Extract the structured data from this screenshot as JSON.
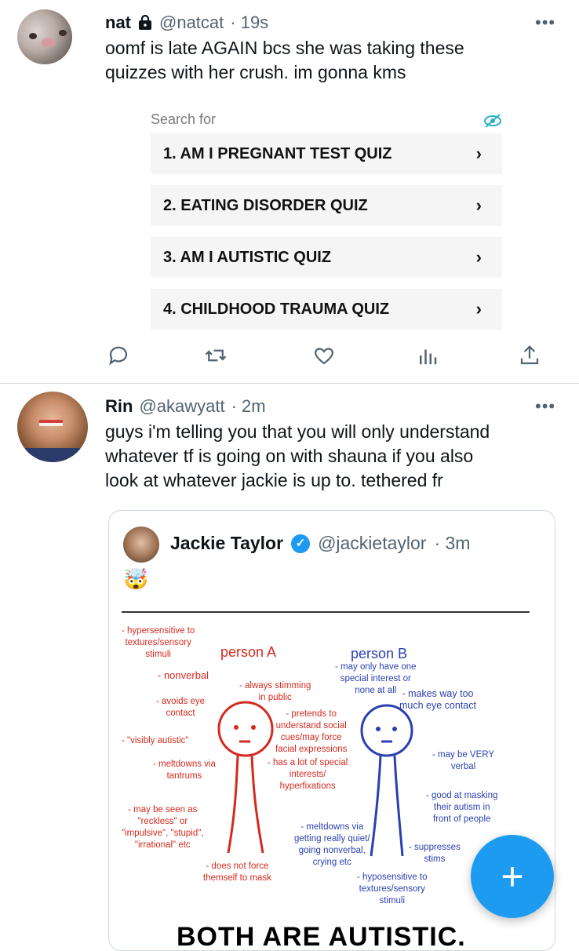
{
  "tweet1": {
    "name": "nat",
    "handle": "@natcat",
    "time": "· 19s",
    "more": "•••",
    "text_lines": [
      "oomf is late AGAIN bcs she was taking these",
      "quizzes with her crush. im gonna kms"
    ],
    "image": {
      "search_label": "Search for",
      "items": [
        "1.  AM I PREGNANT TEST QUIZ",
        "2.  EATING DISORDER QUIZ",
        "3.  AM I AUTISTIC QUIZ",
        "4.  CHILDHOOD TRAUMA QUIZ"
      ],
      "chevron": "›"
    }
  },
  "tweet2": {
    "name": "Rin",
    "handle": "@akawyatt",
    "time": "· 2m",
    "more": "•••",
    "text_lines": [
      "guys i'm telling you that you will only understand",
      "whatever tf is going on with shauna if you also",
      "look at whatever jackie is up to. tethered fr"
    ],
    "quote": {
      "name": "Jackie Taylor",
      "handle": "@jackietaylor",
      "time": "· 3m",
      "emoji": "🤯",
      "diagram": {
        "person_a": "person A",
        "person_b": "person B",
        "red_notes": [
          "- hypersensitive to\ntextures/sensory\nstimuli",
          "- nonverbal",
          "- always stimming\nin public",
          "- avoids eye\ncontact",
          "- \"visibly autistic\"",
          "- meltdowns via\ntantrums",
          "- has a lot of special\ninterests/\nhyperfixations",
          "- may be seen as\n\"reckless\" or\n\"impulsive\", \"stupid\",\n\"irrational\" etc",
          "- does not force\nthemself to mask",
          "- pretends to\nunderstand social\ncues/may force\nfacial expressions"
        ],
        "blue_notes": [
          "- may only have one\nspecial interest or\nnone at all",
          "- makes way too\nmuch eye contact",
          "- may be VERY\nverbal",
          "- good at masking\ntheir autism in\nfront of people",
          "- meltdowns via\ngetting really quiet/\ngoing nonverbal,\ncrying etc",
          "- suppresses\nstims",
          "- hyposensitive to\ntextures/sensory\nstimuli"
        ],
        "bottom_text": "BOTH ARE AUTISTIC."
      }
    }
  },
  "fab": {
    "label": "+"
  },
  "colors": {
    "accent": "#1d9bf0",
    "secondary_text": "#536471",
    "red_ink": "#d42a1f",
    "blue_ink": "#2b3fb0"
  }
}
